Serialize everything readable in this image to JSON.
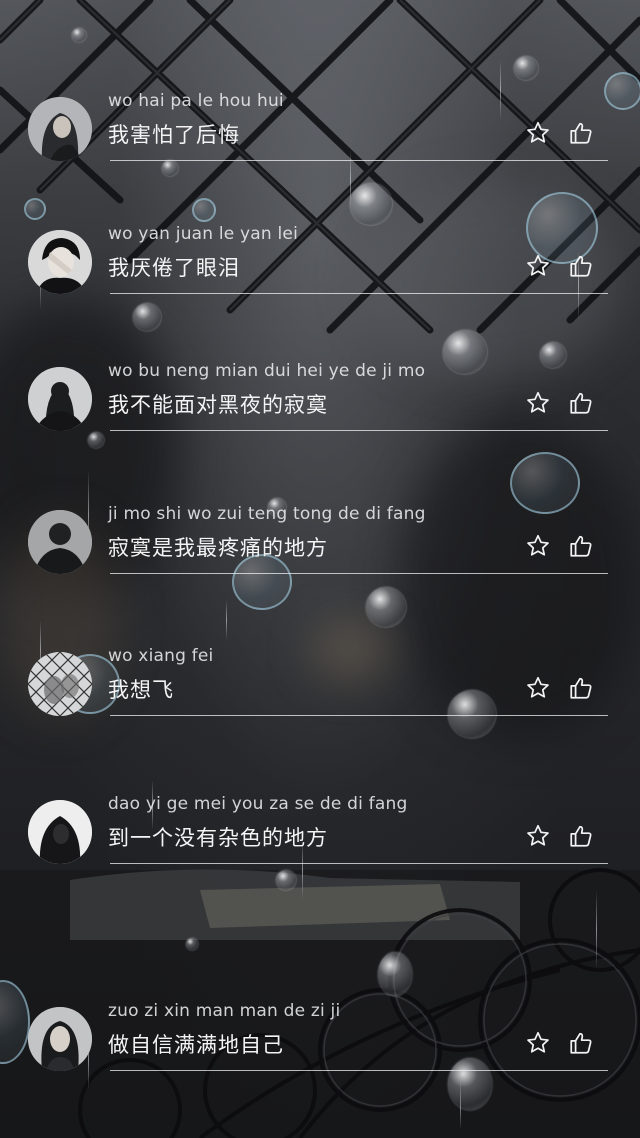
{
  "lyrics": [
    {
      "pinyin": "wo hai pa le hou hui",
      "text": "我害怕了后悔",
      "avatar": "avatar-girl-long-hair",
      "star_icon": "star-outline-icon",
      "like_icon": "thumbs-up-outline-icon"
    },
    {
      "pinyin": "wo yan juan le yan lei",
      "text": "我厌倦了眼泪",
      "avatar": "avatar-boy-hand-over-face",
      "star_icon": "star-outline-icon",
      "like_icon": "thumbs-up-outline-icon"
    },
    {
      "pinyin": "wo bu neng mian dui hei ye de ji mo",
      "text": "我不能面对黑夜的寂寞",
      "avatar": "avatar-silhouette-woman",
      "star_icon": "star-outline-icon",
      "like_icon": "thumbs-up-outline-icon"
    },
    {
      "pinyin": "ji mo shi wo zui teng tong de di fang",
      "text": "寂寞是我最疼痛的地方",
      "avatar": "avatar-silhouette-man",
      "star_icon": "star-outline-icon",
      "like_icon": "thumbs-up-outline-icon"
    },
    {
      "pinyin": "wo xiang fei",
      "text": "我想飞",
      "avatar": "avatar-fence-hands",
      "star_icon": "star-outline-icon",
      "like_icon": "thumbs-up-outline-icon"
    },
    {
      "pinyin": "dao yi ge mei you za se de di fang",
      "text": "到一个没有杂色的地方",
      "avatar": "avatar-hooded-figure",
      "star_icon": "star-outline-icon",
      "like_icon": "thumbs-up-outline-icon"
    },
    {
      "pinyin": "zuo zi xin man man de zi ji",
      "text": "做自信满满地自己",
      "avatar": "avatar-girl-dark-hair",
      "star_icon": "star-outline-icon",
      "like_icon": "thumbs-up-outline-icon"
    }
  ],
  "colors": {
    "text_primary": "#f4f4f5",
    "text_secondary": "#ebeced",
    "divider": "#f0f0f2",
    "background_dark": "#1e1f22"
  }
}
